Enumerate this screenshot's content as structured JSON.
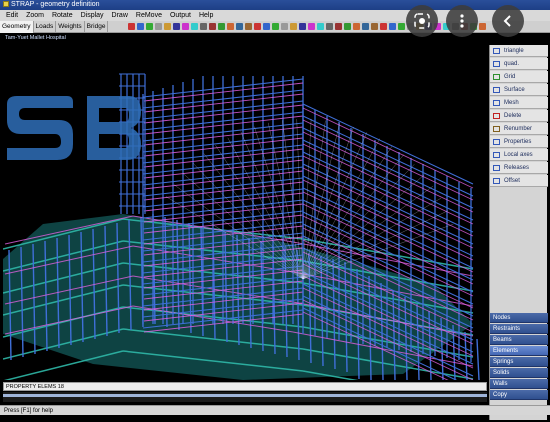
{
  "window": {
    "title": "STRAP - geometry definition"
  },
  "menu": [
    "Edit",
    "Zoom",
    "Rotate",
    "Display",
    "Draw",
    "ReMove",
    "Output",
    "Help"
  ],
  "tabs": [
    "Geometry",
    "Loads",
    "Weights",
    "Bridge"
  ],
  "viewport": {
    "label": "Tam-Yuet Mallet Hospital"
  },
  "right_panel": {
    "commands": [
      {
        "label": "triangle",
        "icon": "triangle-icon"
      },
      {
        "label": "quad.",
        "icon": "quad-icon"
      },
      {
        "label": "Grid",
        "icon": "grid-icon"
      },
      {
        "label": "Surface",
        "icon": "surface-icon"
      },
      {
        "label": "Mesh",
        "icon": "mesh-icon"
      },
      {
        "label": "Delete",
        "icon": "delete-icon"
      },
      {
        "label": "Renumber",
        "icon": "renumber-icon"
      },
      {
        "label": "Properties",
        "icon": "properties-icon"
      },
      {
        "label": "Local axes",
        "icon": "axes-icon"
      },
      {
        "label": "Releases",
        "icon": "releases-icon"
      },
      {
        "label": "Offset",
        "icon": "offset-icon"
      }
    ],
    "groups": [
      "Nodes",
      "Restraints",
      "Beams",
      "Elements",
      "Springs",
      "Solids",
      "Walls",
      "Copy"
    ],
    "active_group": "Elements"
  },
  "property_bar": {
    "text": "PROPERTY ELEMS 18"
  },
  "status": {
    "text": "Press [F1] for help"
  },
  "overlay_buttons": [
    "lens-icon",
    "more-vert-icon",
    "back-icon"
  ],
  "colors": {
    "beam_blue": "#3f6fd8",
    "slab_magenta": "#e060e0",
    "base_teal": "#2fb8a8",
    "title_bar": "#1d3f86"
  }
}
